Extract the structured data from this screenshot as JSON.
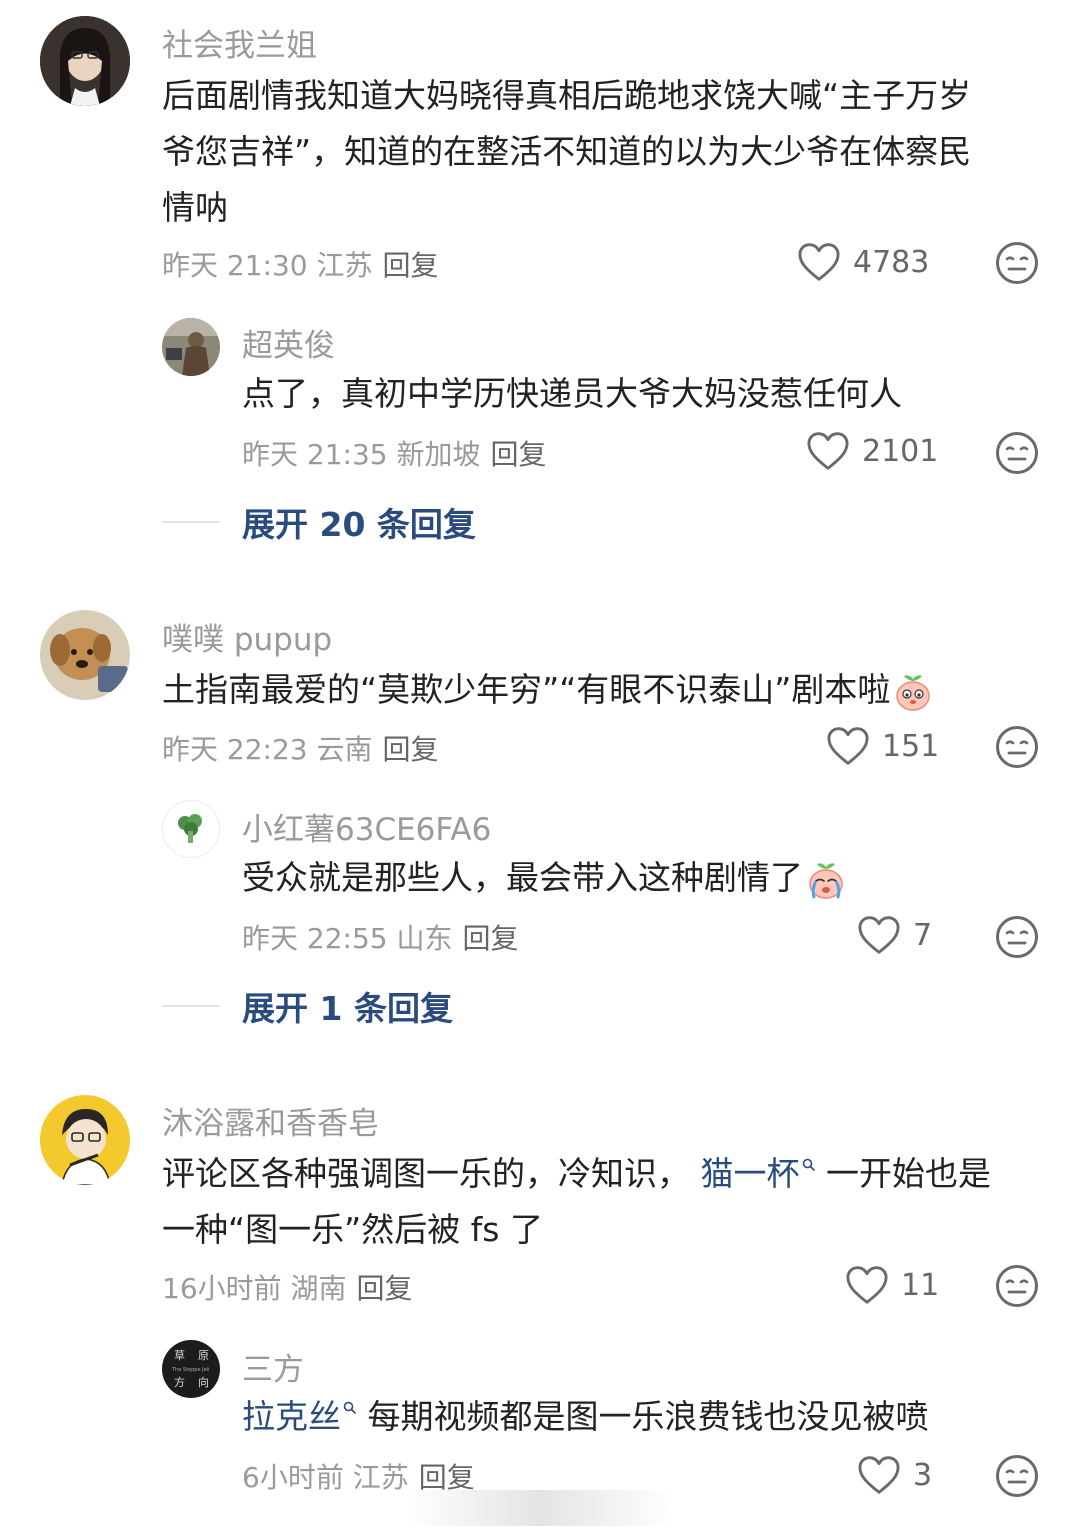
{
  "comments": [
    {
      "username": "社会我兰姐",
      "text_lines": [
        "后面剧情我知道大妈晓得真相后跪地求饶大喊“主子万岁",
        "爷您吉祥”，知道的在整活不知道的以为大少爷在体察民",
        "情呐"
      ],
      "meta": "昨天 21:30 江苏",
      "reply_label": "回复",
      "likes": "4783",
      "replies": [
        {
          "username": "超英俊",
          "text": "点了，真初中学历快递员大爷大妈没惹任何人",
          "meta": "昨天 21:35 新加坡",
          "reply_label": "回复",
          "likes": "2101"
        }
      ],
      "expand_label": "展开 20 条回复"
    },
    {
      "username": "噗噗 pupup",
      "text": "土指南最爱的“莫欺少年穷”“有眼不识泰山”剧本啦",
      "meta": "昨天 22:23 云南",
      "reply_label": "回复",
      "likes": "151",
      "replies": [
        {
          "username": "小红薯63CE6FA6",
          "text": "受众就是那些人，最会带入这种剧情了",
          "meta": "昨天 22:55 山东",
          "reply_label": "回复",
          "likes": "7"
        }
      ],
      "expand_label": "展开 1 条回复"
    },
    {
      "username": "沐浴露和香香皂",
      "text_a": "评论区各种强调图一乐的，冷知识，",
      "mention": "猫一杯",
      "text_b": "一开始也是",
      "text_line2": "一种“图一乐”然后被 fs 了",
      "meta": "16小时前 湖南",
      "reply_label": "回复",
      "likes": "11",
      "replies": [
        {
          "username": "三方",
          "mention": "拉克丝",
          "text": "每期视频都是图一乐浪费钱也没见被喷",
          "meta": "6小时前 江苏",
          "reply_label": "回复",
          "likes": "3"
        }
      ]
    }
  ],
  "avatar_texts": {
    "sanfang": [
      "草",
      "原",
      "The Steppe Jeli",
      "方",
      "向"
    ]
  },
  "colors": {
    "link": "#2a4b7e",
    "meta": "#9a9a9a",
    "text": "#222222"
  },
  "icons": [
    "heart-icon",
    "face-icon",
    "peach-emoji",
    "crying-emoji",
    "search-icon"
  ]
}
